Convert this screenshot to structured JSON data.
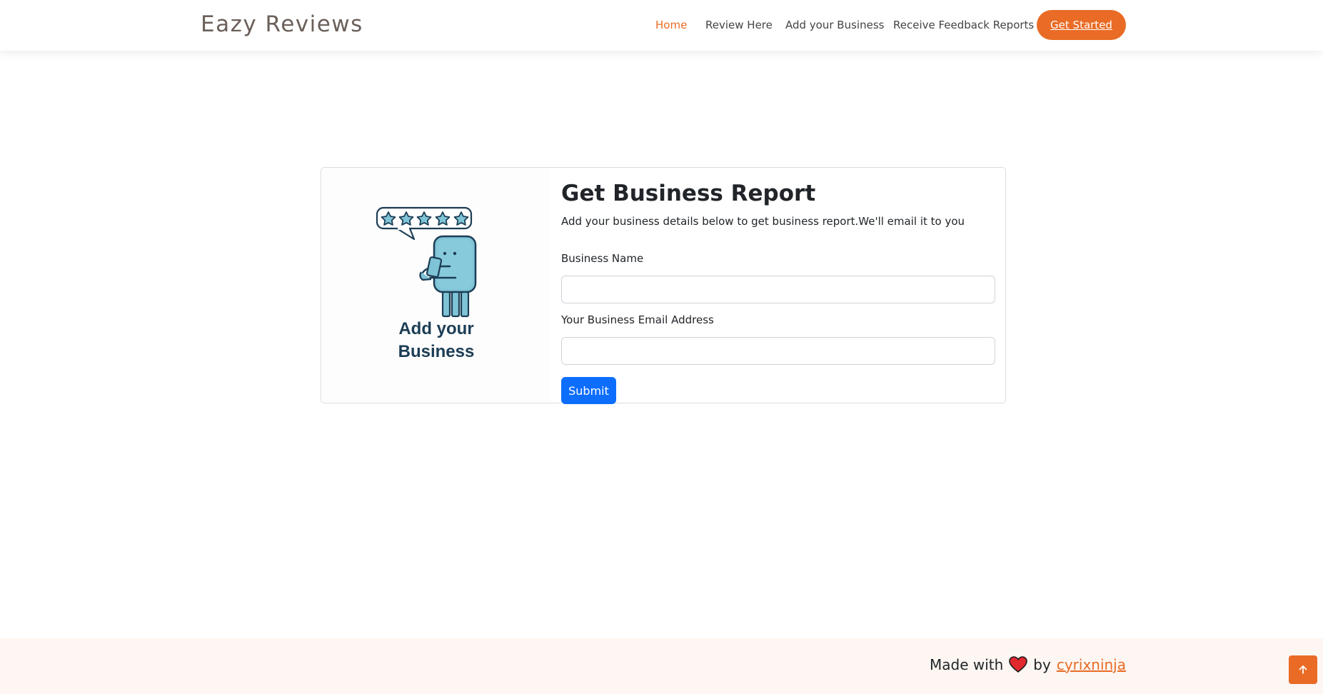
{
  "brand": {
    "logo": "Eazy Reviews",
    "accent_color": "#e96b25"
  },
  "nav": {
    "items": [
      {
        "label": "Home",
        "active": true
      },
      {
        "label": "Review Here",
        "active": false
      },
      {
        "label": "Add your Business",
        "active": false
      },
      {
        "label": "Receive Feedback Reports",
        "active": false
      }
    ],
    "cta_label": "Get Started"
  },
  "card": {
    "illustration": {
      "icon": "reviewer-mascot-icon",
      "line1": "Add your",
      "line2": "Business"
    },
    "title": "Get Business Report",
    "description": "Add your business details below to get business report.We'll email it to you",
    "fields": [
      {
        "label": "Business Name",
        "value": "",
        "placeholder": ""
      },
      {
        "label": "Your Business Email Address",
        "value": "",
        "placeholder": ""
      }
    ],
    "submit_label": "Submit",
    "submit_color": "#0d6efd"
  },
  "footer": {
    "made_with": "Made with",
    "heart_icon": "heart-icon",
    "by": "by",
    "author": "cyrixninja",
    "footer_bg": "#fdf6f2"
  },
  "back_to_top": {
    "icon": "arrow-up-icon"
  }
}
